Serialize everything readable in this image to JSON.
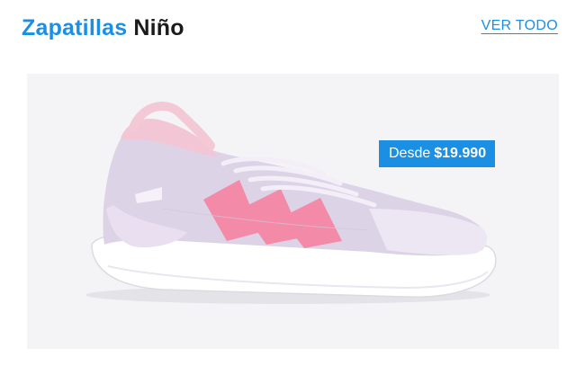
{
  "header": {
    "title_accent": "Zapatillas",
    "title_rest": "Niño",
    "view_all_label": "VER TODO"
  },
  "product": {
    "price_prefix": "Desde",
    "price": "$19.990"
  },
  "colors": {
    "accent": "#1a8fe3",
    "card_bg": "#f4f4f6"
  }
}
